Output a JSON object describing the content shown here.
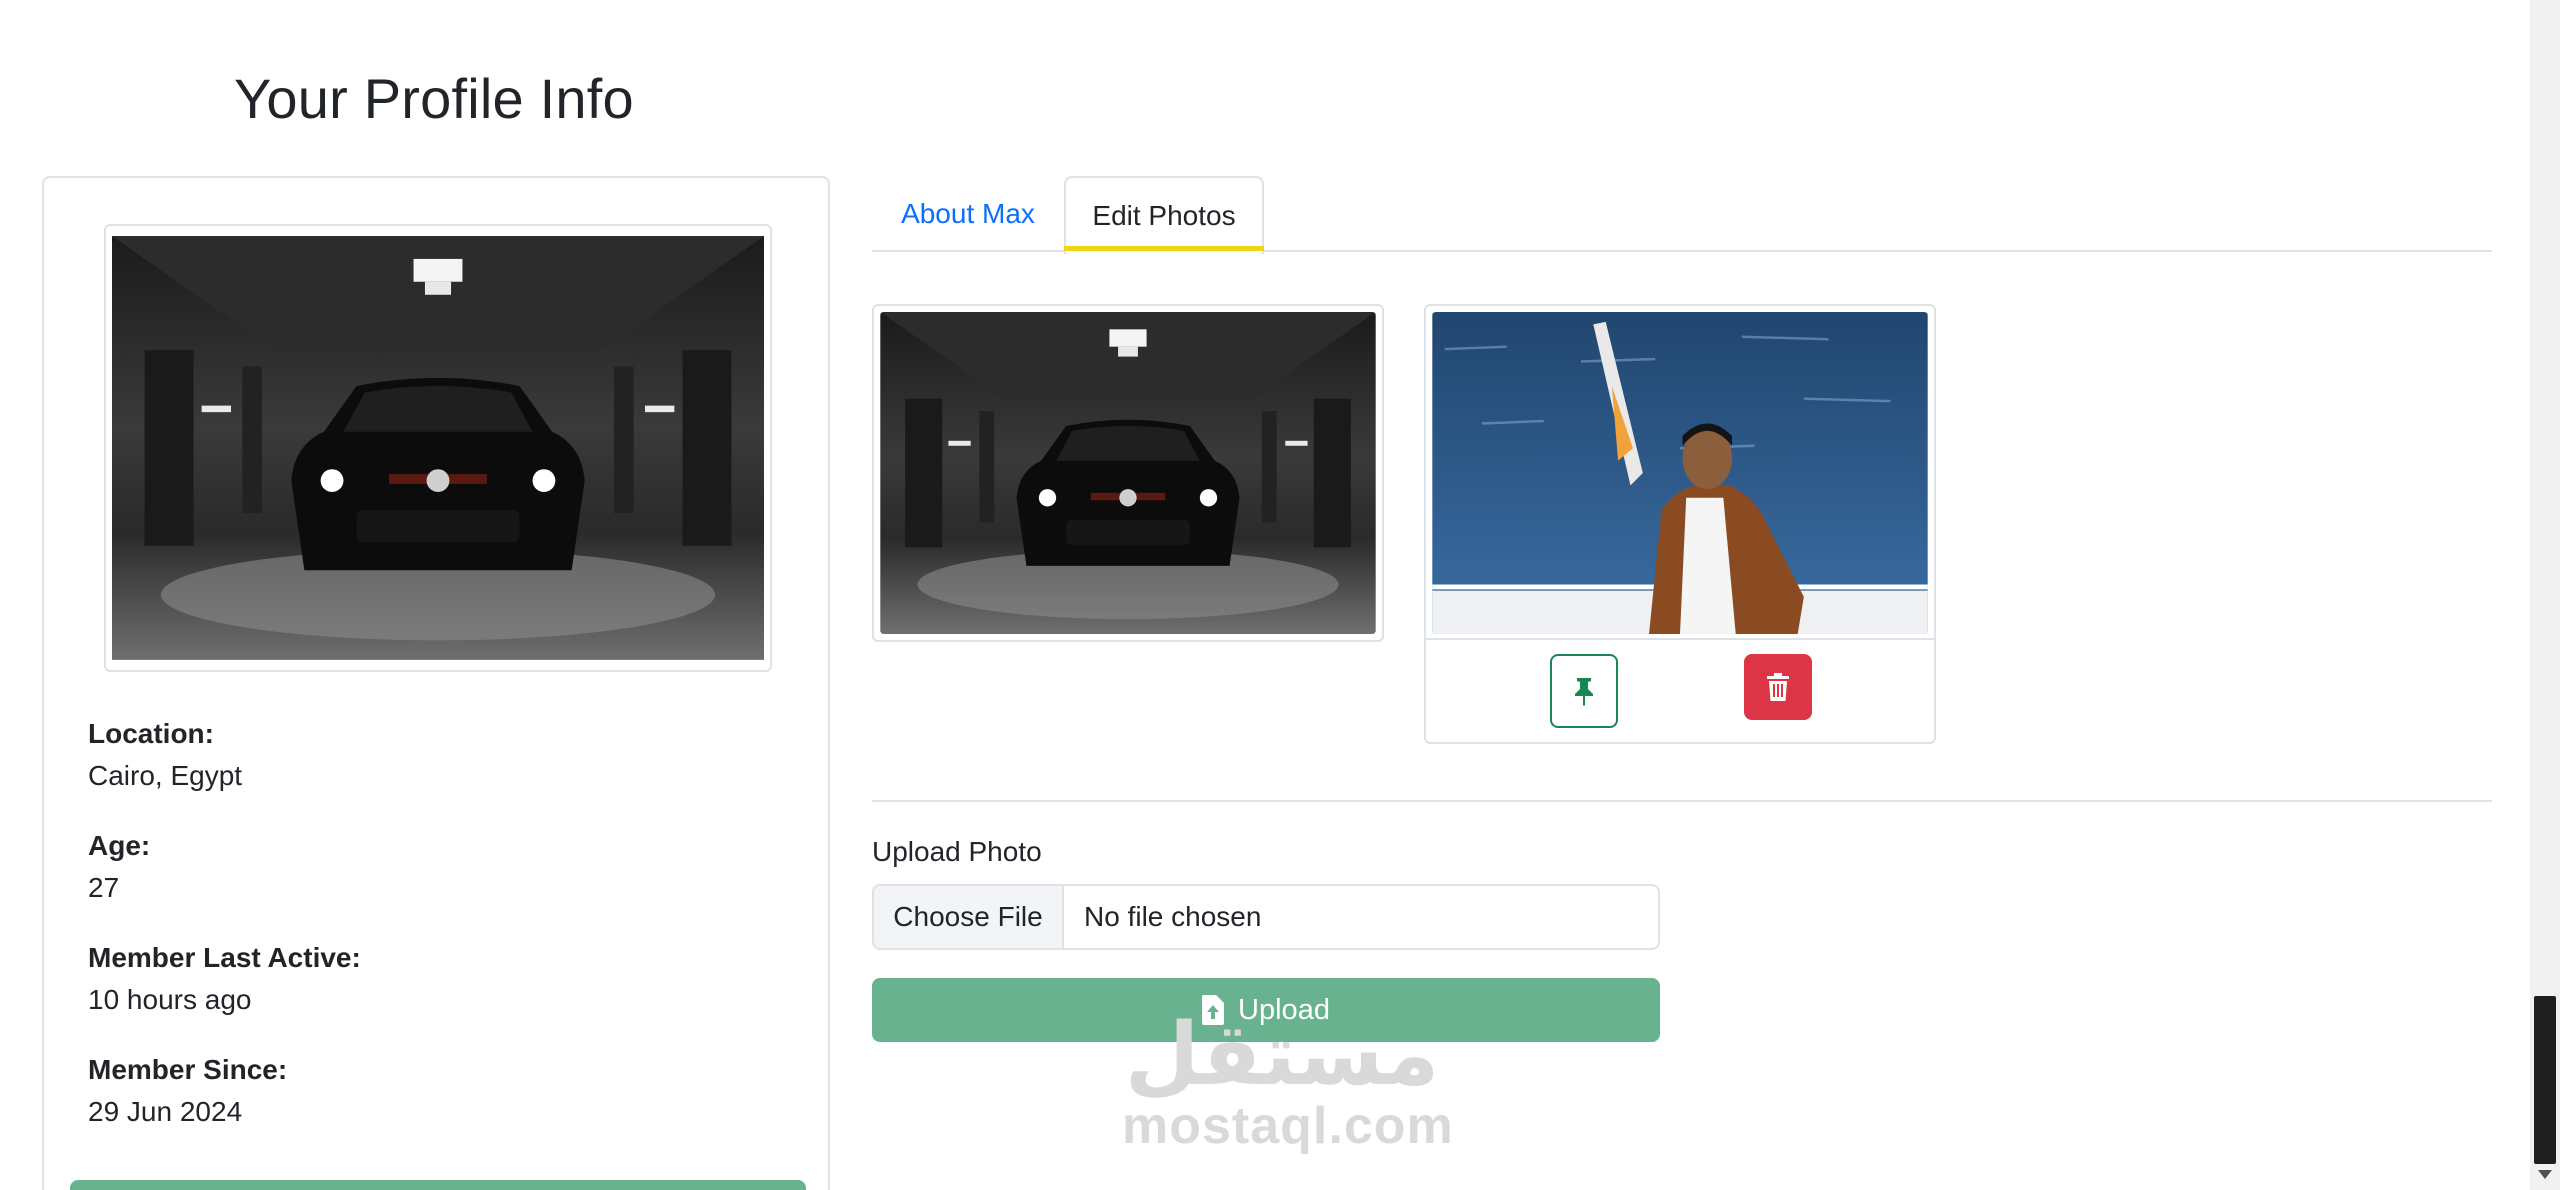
{
  "header": {
    "title": "Your Profile Info"
  },
  "profile": {
    "location_label": "Location:",
    "location_value": "Cairo, Egypt",
    "age_label": "Age:",
    "age_value": "27",
    "last_active_label": "Member Last Active:",
    "last_active_value": "10 hours ago",
    "since_label": "Member Since:",
    "since_value": "29 Jun 2024"
  },
  "tabs": [
    {
      "label": "About Max",
      "active": false
    },
    {
      "label": "Edit Photos",
      "active": true
    }
  ],
  "photos": {
    "actions": {
      "set_main_icon": "pin-icon",
      "delete_icon": "trash-icon"
    }
  },
  "upload": {
    "label": "Upload Photo",
    "choose_label": "Choose File",
    "file_status": "No file chosen",
    "button_label": "Upload",
    "button_icon": "file-upload-icon"
  },
  "watermark": {
    "arabic": "مستقل",
    "latin": "mostaql.com"
  },
  "colors": {
    "link": "#0d6efd",
    "tab_accent": "#f0d417",
    "success": "#198754",
    "upload_button": "#69b28f",
    "danger": "#dc3545",
    "border": "#dee2e6"
  }
}
